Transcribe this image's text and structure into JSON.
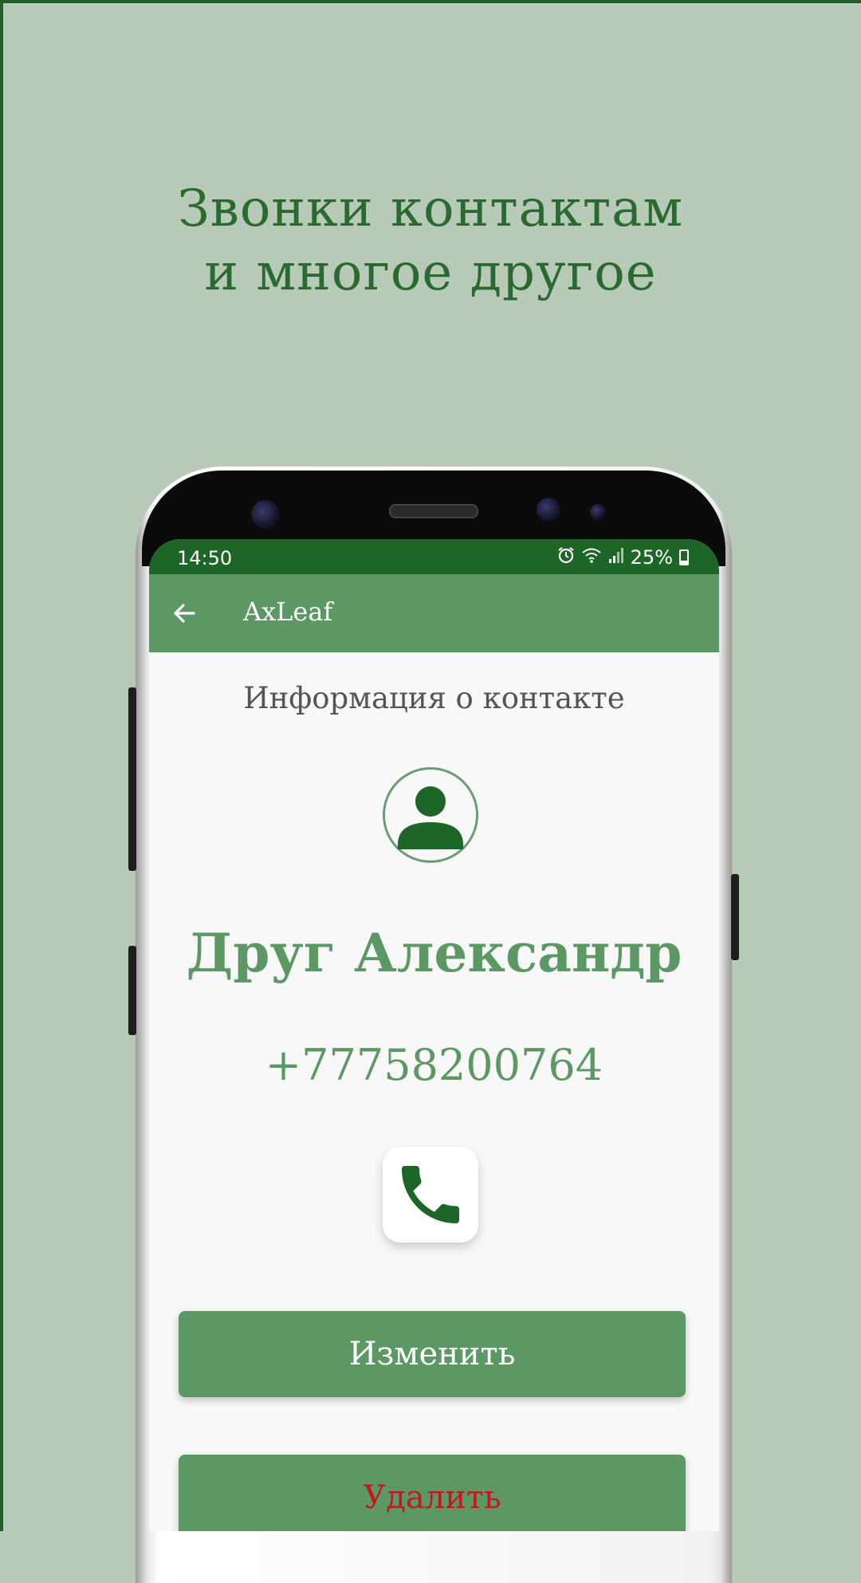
{
  "promo": {
    "headline_line1": "Звонки контактам",
    "headline_line2": "и многое другое"
  },
  "status_bar": {
    "time": "14:50",
    "battery": "25%",
    "battery_level": 0.25,
    "icons": [
      "alarm-icon",
      "wifi-icon",
      "signal-icon",
      "battery-icon"
    ]
  },
  "app_bar": {
    "title": "AxLeaf",
    "back_icon": "arrow-left-icon"
  },
  "contact_info": {
    "section_title": "Информация о контакте",
    "avatar_icon": "person-icon",
    "name": "Друг Александр",
    "phone": "+77758200764",
    "call_icon": "phone-icon"
  },
  "actions": {
    "edit_label": "Изменить",
    "delete_label": "Удалить"
  },
  "colors": {
    "background": "#b7c9b7",
    "primary_dark": "#1e6528",
    "primary": "#5b9864",
    "delete_text": "#c9151b",
    "headline": "#2a6a30"
  }
}
